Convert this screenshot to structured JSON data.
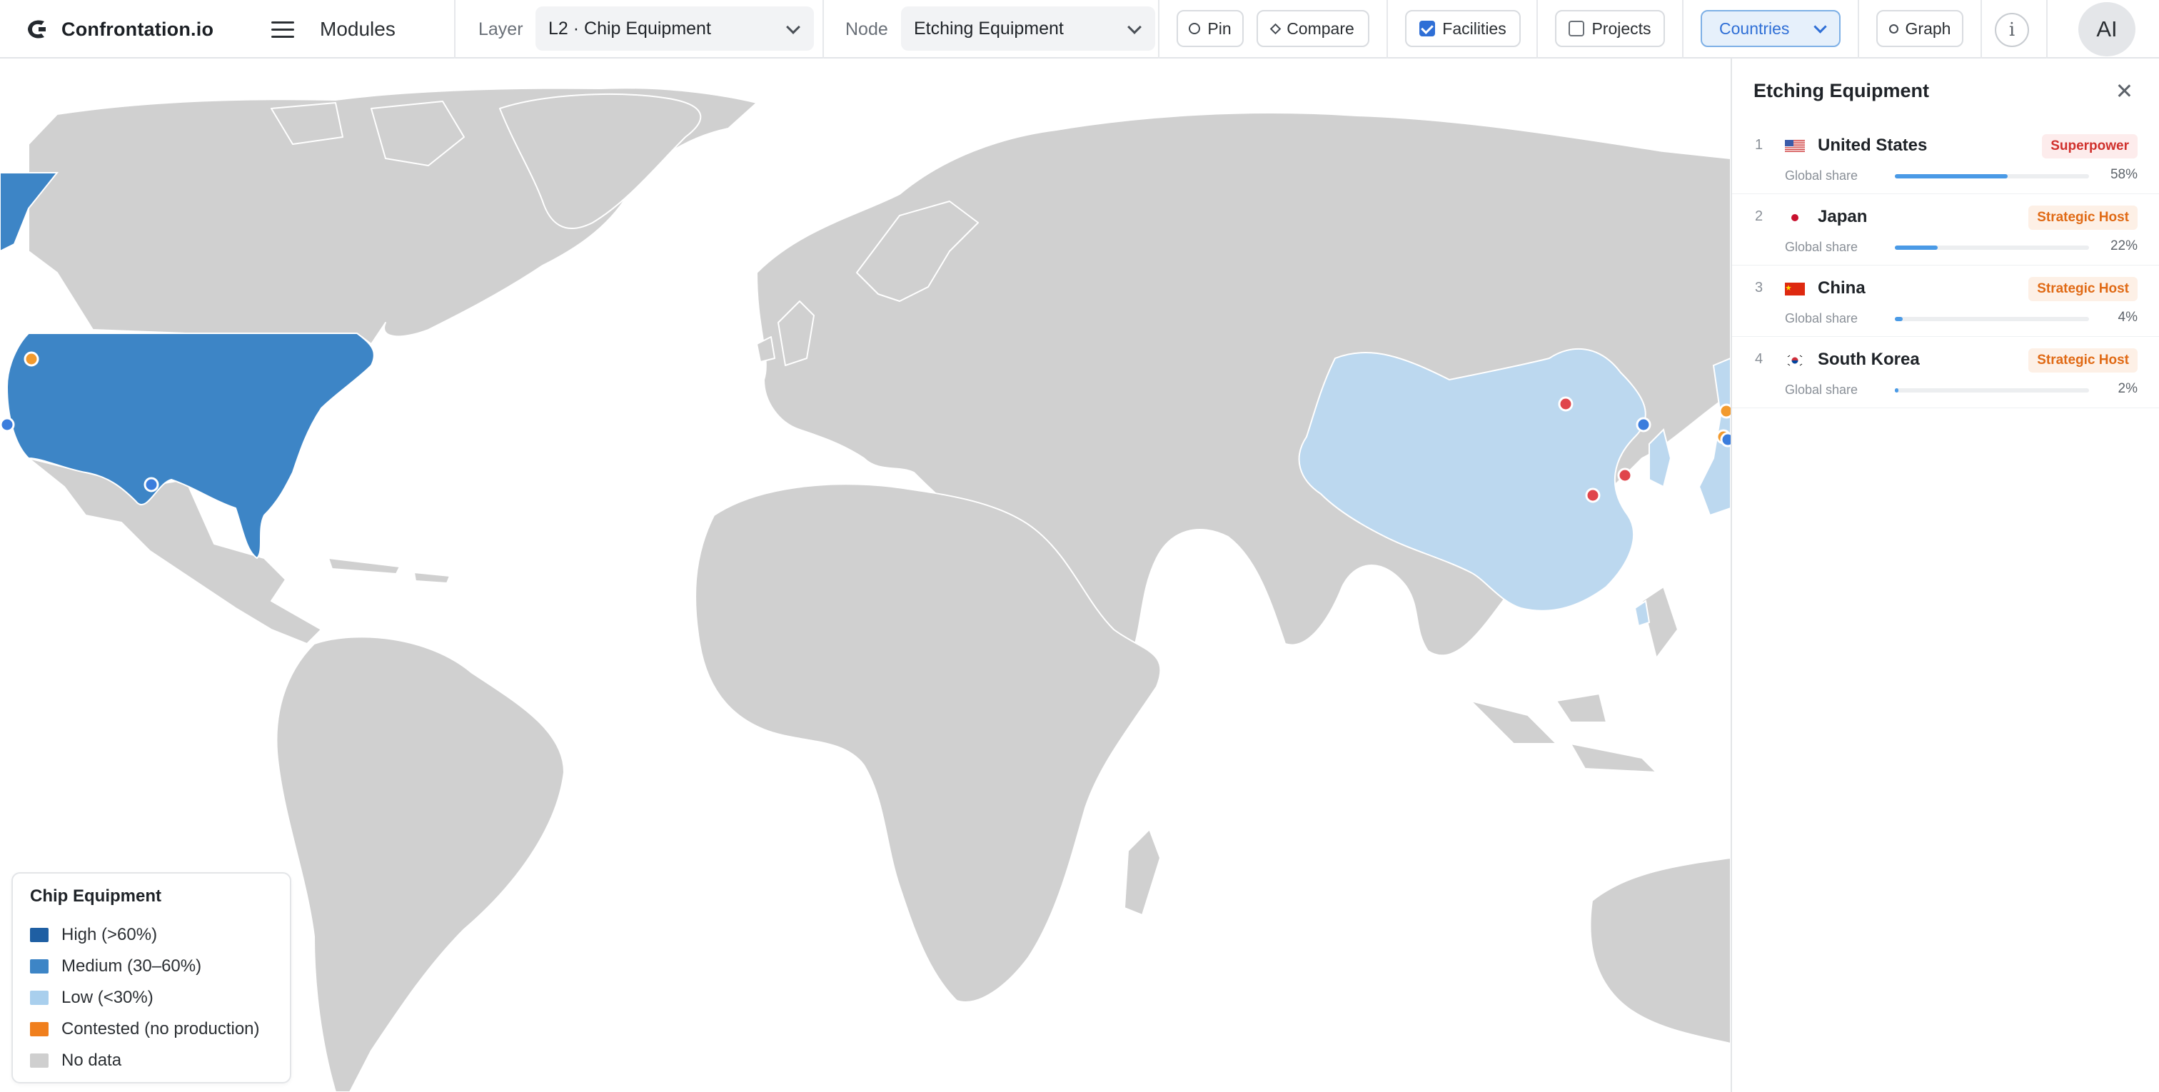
{
  "app": {
    "name": "Confrontation.io",
    "modules_label": "Modules",
    "logo_icon": "c-logo-icon"
  },
  "toolbar": {
    "layer_label": "Layer",
    "layer_value": "L2 · Chip Equipment",
    "node_label": "Node",
    "node_value": "Etching Equipment",
    "pin_label": "Pin",
    "compare_label": "Compare",
    "facilities_label": "Facilities",
    "facilities_checked": true,
    "projects_label": "Projects",
    "projects_checked": false,
    "view_value": "Countries",
    "graph_label": "Graph",
    "info_icon": "info-icon",
    "avatar_text": "AI"
  },
  "legend": {
    "title": "Chip Equipment",
    "items": [
      {
        "label": "High (>60%)",
        "color": "#1f5fa3"
      },
      {
        "label": "Medium (30–60%)",
        "color": "#3d85c6"
      },
      {
        "label": "Low (<30%)",
        "color": "#a9cfed"
      },
      {
        "label": "Contested (no production)",
        "color": "#f07f1d"
      },
      {
        "label": "No data",
        "color": "#cfcfcf"
      }
    ]
  },
  "map": {
    "land_color": "#d0d0d0",
    "medium_color": "#3d85c6",
    "low_color": "#bcd8ef",
    "facility_colors": {
      "us": "#3b7ddd",
      "china": "#e0454b",
      "contested": "#f29a2e"
    }
  },
  "panel": {
    "title": "Etching Equipment",
    "share_label": "Global share",
    "rows": [
      {
        "rank": "1",
        "country": "United States",
        "badge": "Superpower",
        "badge_type": "super",
        "share": 0.58,
        "share_text": "58%",
        "flag": "us-flag"
      },
      {
        "rank": "2",
        "country": "Japan",
        "badge": "Strategic Host",
        "badge_type": "host",
        "share": 0.22,
        "share_text": "22%",
        "flag": "japan-flag"
      },
      {
        "rank": "3",
        "country": "China",
        "badge": "Strategic Host",
        "badge_type": "host",
        "share": 0.04,
        "share_text": "4%",
        "flag": "china-flag"
      },
      {
        "rank": "4",
        "country": "South Korea",
        "badge": "Strategic Host",
        "badge_type": "host",
        "share": 0.02,
        "share_text": "2%",
        "flag": "south-korea-flag"
      }
    ]
  }
}
